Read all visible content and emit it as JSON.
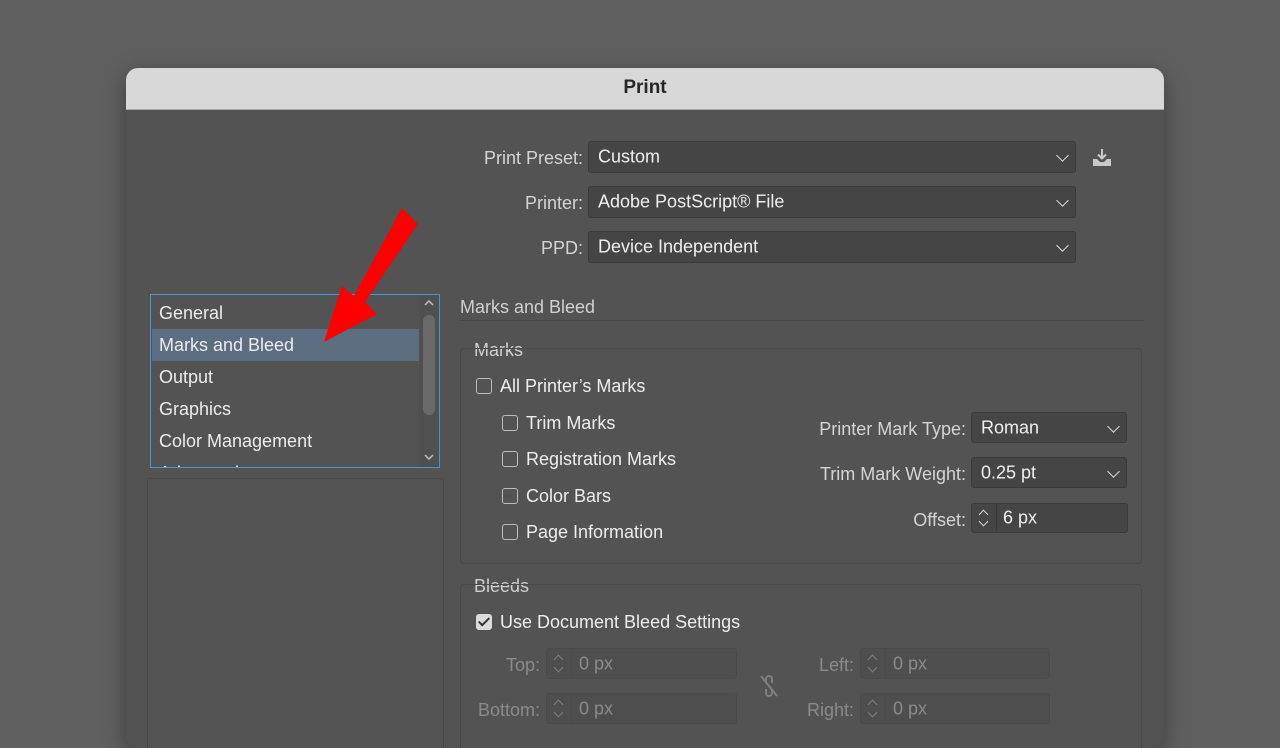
{
  "dialog": {
    "title": "Print"
  },
  "top": {
    "preset_label": "Print Preset:",
    "preset_value": "Custom",
    "printer_label": "Printer:",
    "printer_value": "Adobe PostScript® File",
    "ppd_label": "PPD:",
    "ppd_value": "Device Independent",
    "save_preset_icon": "download-icon"
  },
  "sidebar": {
    "items": [
      "General",
      "Marks and Bleed",
      "Output",
      "Graphics",
      "Color Management",
      "Advanced"
    ],
    "selected": "Marks and Bleed"
  },
  "section": {
    "title": "Marks and Bleed"
  },
  "marks": {
    "group_title": "Marks",
    "all_label": "All Printer’s Marks",
    "all_checked": false,
    "trim_label": "Trim Marks",
    "registration_label": "Registration Marks",
    "colorbars_label": "Color Bars",
    "pageinfo_label": "Page Information",
    "mark_type_label": "Printer Mark Type:",
    "mark_type_value": "Roman",
    "trim_weight_label": "Trim Mark Weight:",
    "trim_weight_value": "0.25 pt",
    "offset_label": "Offset:",
    "offset_value": "6 px"
  },
  "bleeds": {
    "group_title": "Bleeds",
    "use_doc_label": "Use Document Bleed Settings",
    "use_doc_checked": true,
    "top_label": "Top:",
    "top_value": "0 px",
    "bottom_label": "Bottom:",
    "bottom_value": "0 px",
    "left_label": "Left:",
    "left_value": "0 px",
    "right_label": "Right:",
    "right_value": "0 px",
    "link_icon": "broken-link-icon"
  },
  "annotation": {
    "arrow_color": "#ff0000"
  }
}
